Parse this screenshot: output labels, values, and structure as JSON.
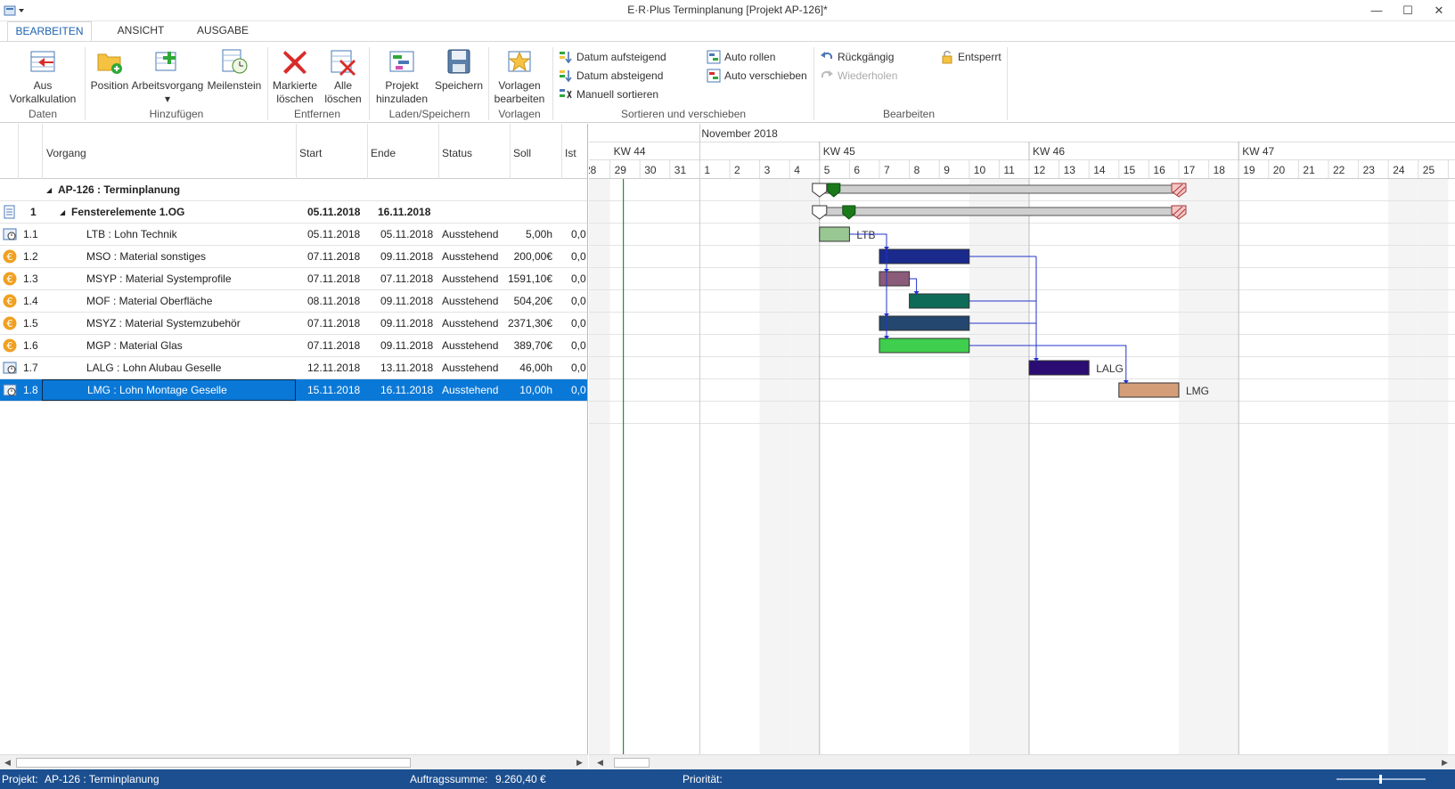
{
  "window": {
    "title": "E·R·Plus Terminplanung [Projekt AP-126]*",
    "minimize": "—",
    "maximize": "☐",
    "close": "✕"
  },
  "tabs": [
    {
      "label": "BEARBEITEN",
      "active": true
    },
    {
      "label": "ANSICHT",
      "active": false
    },
    {
      "label": "AUSGABE",
      "active": false
    }
  ],
  "ribbon": {
    "buttons": {
      "aus_vorkalkulation": {
        "line1": "Aus",
        "line2": "Vorkalkulation"
      },
      "position": {
        "line1": "Position"
      },
      "arbeitsvorgang": {
        "line1": "Arbeitsvorgang",
        "line2": "▾"
      },
      "meilenstein": {
        "line1": "Meilenstein"
      },
      "markierte_loeschen": {
        "line1": "Markierte",
        "line2": "löschen"
      },
      "alle_loeschen": {
        "line1": "Alle",
        "line2": "löschen"
      },
      "projekt_hinzuladen": {
        "line1": "Projekt",
        "line2": "hinzuladen"
      },
      "speichern": {
        "line1": "Speichern"
      },
      "vorlagen_bearbeiten": {
        "line1": "Vorlagen",
        "line2": "bearbeiten"
      }
    },
    "small_buttons": {
      "datum_aufsteigend": "Datum aufsteigend",
      "datum_absteigend": "Datum absteigend",
      "manuell_sortieren": "Manuell sortieren",
      "auto_rollen": "Auto rollen",
      "auto_verschieben": "Auto verschieben",
      "rueckgaengig": "Rückgängig",
      "wiederholen": "Wiederholen",
      "entsperrt": "Entsperrt"
    },
    "groups": {
      "daten": "Daten",
      "hinzufuegen": "Hinzufügen",
      "entfernen": "Entfernen",
      "laden_speichern": "Laden/Speichern",
      "vorlagen": "Vorlagen",
      "sortieren": "Sortieren und verschieben",
      "bearbeiten": "Bearbeiten"
    }
  },
  "grid": {
    "headers": {
      "vorgang": "Vorgang",
      "start": "Start",
      "ende": "Ende",
      "status": "Status",
      "soll": "Soll",
      "ist": "Ist"
    },
    "project": {
      "label": "AP-126 : Terminplanung",
      "toggle": "◢"
    },
    "group": {
      "nr": "1",
      "label": "Fensterelemente 1.OG",
      "start": "05.11.2018",
      "ende": "16.11.2018",
      "toggle": "◢"
    },
    "rows": [
      {
        "nr": "1.1",
        "icon": "work-icon",
        "label": "LTB : Lohn Technik",
        "start": "05.11.2018",
        "ende": "05.11.2018",
        "status": "Ausstehend",
        "soll": "5,00h",
        "ist": "0,0"
      },
      {
        "nr": "1.2",
        "icon": "euro-icon",
        "label": "MSO : Material sonstiges",
        "start": "07.11.2018",
        "ende": "09.11.2018",
        "status": "Ausstehend",
        "soll": "200,00€",
        "ist": "0,0"
      },
      {
        "nr": "1.3",
        "icon": "euro-icon",
        "label": "MSYP : Material Systemprofile",
        "start": "07.11.2018",
        "ende": "07.11.2018",
        "status": "Ausstehend",
        "soll": "1591,10€",
        "ist": "0,0"
      },
      {
        "nr": "1.4",
        "icon": "euro-icon",
        "label": "MOF : Material Oberfläche",
        "start": "08.11.2018",
        "ende": "09.11.2018",
        "status": "Ausstehend",
        "soll": "504,20€",
        "ist": "0,0"
      },
      {
        "nr": "1.5",
        "icon": "euro-icon",
        "label": "MSYZ : Material Systemzubehör",
        "start": "07.11.2018",
        "ende": "09.11.2018",
        "status": "Ausstehend",
        "soll": "2371,30€",
        "ist": "0,0"
      },
      {
        "nr": "1.6",
        "icon": "euro-icon",
        "label": "MGP : Material Glas",
        "start": "07.11.2018",
        "ende": "09.11.2018",
        "status": "Ausstehend",
        "soll": "389,70€",
        "ist": "0,0"
      },
      {
        "nr": "1.7",
        "icon": "work-icon",
        "label": "LALG : Lohn Alubau Geselle",
        "start": "12.11.2018",
        "ende": "13.11.2018",
        "status": "Ausstehend",
        "soll": "46,00h",
        "ist": "0,0"
      },
      {
        "nr": "1.8",
        "icon": "work-icon",
        "label": "LMG : Lohn Montage Geselle",
        "start": "15.11.2018",
        "ende": "16.11.2018",
        "status": "Ausstehend",
        "soll": "10,00h",
        "ist": "0,0",
        "selected": true
      }
    ]
  },
  "gantt": {
    "month": "November 2018",
    "weeks": [
      "KW 44",
      "KW 45",
      "KW 46",
      "KW 47"
    ],
    "days": [
      "28",
      "29",
      "30",
      "31",
      "1",
      "2",
      "3",
      "4",
      "5",
      "6",
      "7",
      "8",
      "9",
      "10",
      "11",
      "12",
      "13",
      "14",
      "15",
      "16",
      "17",
      "18",
      "19",
      "20",
      "21",
      "22",
      "23",
      "24",
      "25"
    ],
    "today_index": 1,
    "bars": [
      {
        "row": 0,
        "type": "summary",
        "start_day": "05.11.2018",
        "end_day": "16.11.2018"
      },
      {
        "row": 1,
        "type": "summary",
        "start_day": "05.11.2018",
        "end_day": "16.11.2018"
      },
      {
        "row": 2,
        "start": 8,
        "end": 9,
        "color": "#99c793",
        "label": "LTB"
      },
      {
        "row": 3,
        "start": 10,
        "end": 13,
        "color": "#1a2a8c",
        "label": ""
      },
      {
        "row": 4,
        "start": 10,
        "end": 11,
        "color": "#8a5c7a",
        "label": ""
      },
      {
        "row": 5,
        "start": 11,
        "end": 13,
        "color": "#0d6b58",
        "label": ""
      },
      {
        "row": 6,
        "start": 10,
        "end": 13,
        "color": "#23476e",
        "label": ""
      },
      {
        "row": 7,
        "start": 10,
        "end": 13,
        "color": "#3fce4d",
        "label": ""
      },
      {
        "row": 8,
        "start": 15,
        "end": 17,
        "color": "#2a0c72",
        "label": "LALG"
      },
      {
        "row": 9,
        "start": 18,
        "end": 20,
        "color": "#d49e78",
        "label": "LMG"
      }
    ]
  },
  "status": {
    "projekt_label": "Projekt:",
    "projekt_value": "AP-126 : Terminplanung",
    "summe_label": "Auftragssumme:",
    "summe_value": "9.260,40 €",
    "prioritaet_label": "Priorität:"
  }
}
